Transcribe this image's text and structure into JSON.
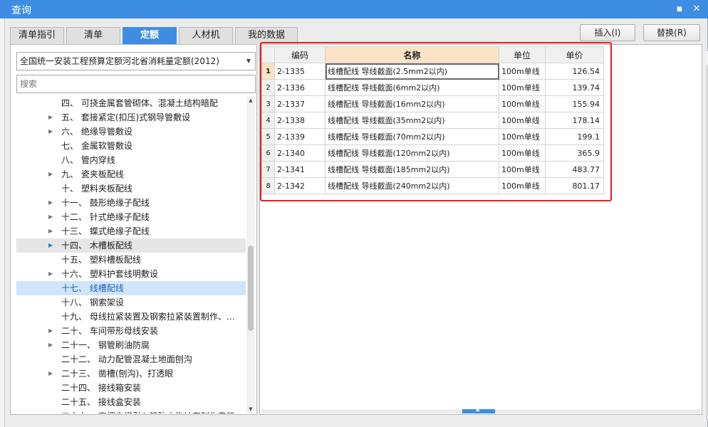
{
  "window": {
    "title": "查询",
    "minimize": "▪",
    "close": "✕"
  },
  "tabs": [
    {
      "label": "清单指引"
    },
    {
      "label": "清单"
    },
    {
      "label": "定额"
    },
    {
      "label": "人材机"
    },
    {
      "label": "我的数据"
    }
  ],
  "active_tab": "定额",
  "buttons": {
    "insert": "插入(I)",
    "replace": "替换(R)"
  },
  "left": {
    "library": "全国统一安装工程预算定额河北省消耗量定额(2012)",
    "search_placeholder": "搜索",
    "tree": [
      {
        "text": "四、 可挠金属套管砌体、混凝土结构暗配",
        "expandable": false
      },
      {
        "text": "五、 套接紧定(扣压)式钢导管敷设",
        "expandable": true
      },
      {
        "text": "六、 绝缘导管敷设",
        "expandable": true
      },
      {
        "text": "七、 金属软管敷设",
        "expandable": false
      },
      {
        "text": "八、 管内穿线",
        "expandable": false
      },
      {
        "text": "九、 瓷夹板配线",
        "expandable": true
      },
      {
        "text": "十、 塑料夹板配线",
        "expandable": false
      },
      {
        "text": "十一、 鼓形绝缘子配线",
        "expandable": true
      },
      {
        "text": "十二、 针式绝缘子配线",
        "expandable": true
      },
      {
        "text": "十三、 蝶式绝缘子配线",
        "expandable": true
      },
      {
        "text": "十四、 木槽板配线",
        "expandable": true
      },
      {
        "text": "十五、 塑料槽板配线",
        "expandable": false
      },
      {
        "text": "十六、 塑料护套线明敷设",
        "expandable": true
      },
      {
        "text": "十七、 线槽配线",
        "expandable": false
      },
      {
        "text": "十八、 钢索架设",
        "expandable": false
      },
      {
        "text": "十九、 母线拉紧装置及钢索拉紧装置制作、…",
        "expandable": false
      },
      {
        "text": "二十、 车间带形母线安装",
        "expandable": true
      },
      {
        "text": "二十一、 钢管刷油防腐",
        "expandable": true
      },
      {
        "text": "二十二、 动力配管混凝土地面刨沟",
        "expandable": false
      },
      {
        "text": "二十三、 凿槽(刨沟)、打透眼",
        "expandable": true
      },
      {
        "text": "二十四、 接线箱安装",
        "expandable": false
      },
      {
        "text": "二十五、 接线盒安装",
        "expandable": false
      },
      {
        "text": "二十六、 直埋电缆引入管防水沟护套制作安装",
        "expandable": false
      }
    ],
    "hover_item": "十四、 木槽板配线",
    "selected_item": "十七、 线槽配线"
  },
  "grid": {
    "headers": {
      "code": "编码",
      "name": "名称",
      "unit": "单位",
      "price": "单价"
    },
    "rows": [
      {
        "n": "1",
        "code": "2-1335",
        "name": "线槽配线 导线截面(2.5mm2以内)",
        "unit": "100m单线",
        "price": "126.54"
      },
      {
        "n": "2",
        "code": "2-1336",
        "name": "线槽配线 导线截面(6mm2以内)",
        "unit": "100m单线",
        "price": "139.74"
      },
      {
        "n": "3",
        "code": "2-1337",
        "name": "线槽配线 导线截面(16mm2以内)",
        "unit": "100m单线",
        "price": "155.94"
      },
      {
        "n": "4",
        "code": "2-1338",
        "name": "线槽配线 导线截面(35mm2以内)",
        "unit": "100m单线",
        "price": "178.14"
      },
      {
        "n": "5",
        "code": "2-1339",
        "name": "线槽配线 导线截面(70mm2以内)",
        "unit": "100m单线",
        "price": "199.1"
      },
      {
        "n": "6",
        "code": "2-1340",
        "name": "线槽配线 导线截面(120mm2以内)",
        "unit": "100m单线",
        "price": "365.9"
      },
      {
        "n": "7",
        "code": "2-1341",
        "name": "线槽配线 导线截面(185mm2以内)",
        "unit": "100m单线",
        "price": "483.77"
      },
      {
        "n": "8",
        "code": "2-1342",
        "name": "线槽配线 导线截面(240mm2以内)",
        "unit": "100m单线",
        "price": "801.17"
      }
    ]
  },
  "scroll_grip": "▲",
  "colors": {
    "accent": "#3d8ee2",
    "highlight_box": "#e02020",
    "header_highlight": "#fbe3c6",
    "selection": "#cfe5fb"
  }
}
